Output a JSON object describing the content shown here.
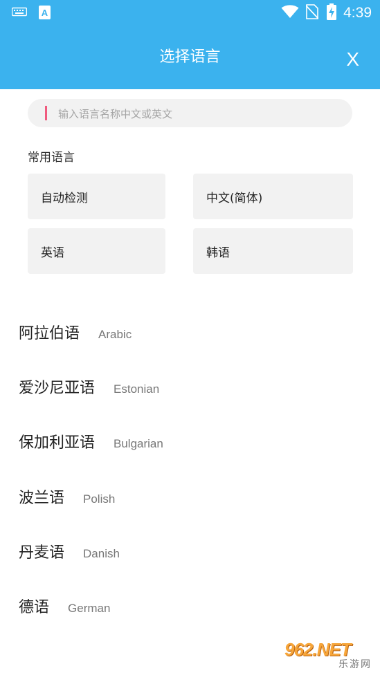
{
  "status_bar": {
    "time": "4:39",
    "icons": [
      "keyboard-icon",
      "text-input-icon",
      "wifi-icon",
      "no-sim-icon",
      "battery-charging-icon"
    ],
    "input_icon_letter": "A"
  },
  "header": {
    "title": "选择语言",
    "close_label": "X"
  },
  "search": {
    "placeholder": "输入语言名称中文或英文",
    "value": ""
  },
  "common": {
    "label": "常用语言",
    "tiles": [
      {
        "label": "自动检测"
      },
      {
        "label": "中文(简体)"
      },
      {
        "label": "英语"
      },
      {
        "label": "韩语"
      }
    ]
  },
  "languages": [
    {
      "cn": "阿拉伯语",
      "en": "Arabic"
    },
    {
      "cn": "爱沙尼亚语",
      "en": "Estonian"
    },
    {
      "cn": "保加利亚语",
      "en": "Bulgarian"
    },
    {
      "cn": "波兰语",
      "en": "Polish"
    },
    {
      "cn": "丹麦语",
      "en": "Danish"
    },
    {
      "cn": "德语",
      "en": "German"
    }
  ],
  "watermark": {
    "brand": "962.NET",
    "sub": "乐游网"
  },
  "colors": {
    "accent": "#3bb2ee",
    "cursor": "#f05a7e",
    "tile_bg": "#f2f2f2"
  }
}
